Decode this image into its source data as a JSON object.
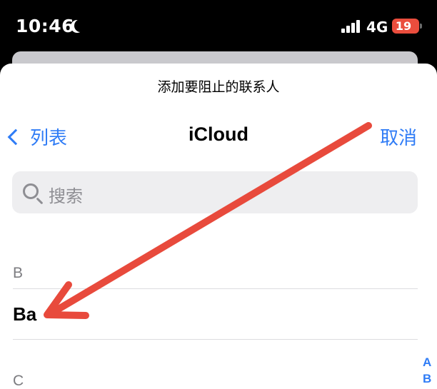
{
  "status_bar": {
    "time": "10:46",
    "network": "4G",
    "battery": "19",
    "icons": [
      "moon-icon",
      "signal-icon",
      "battery-icon"
    ]
  },
  "sheet": {
    "title": "添加要阻止的联系人"
  },
  "nav": {
    "back_label": "列表",
    "title": "iCloud",
    "cancel_label": "取消"
  },
  "search": {
    "placeholder": "搜索"
  },
  "sections": [
    {
      "letter": "B",
      "contacts": [
        "Ba"
      ]
    },
    {
      "letter": "C",
      "contacts": []
    }
  ],
  "index": [
    "A",
    "B"
  ],
  "colors": {
    "accent": "#2f7cf6",
    "annotation": "#e84a3c",
    "battery": "#ea4d3d"
  }
}
